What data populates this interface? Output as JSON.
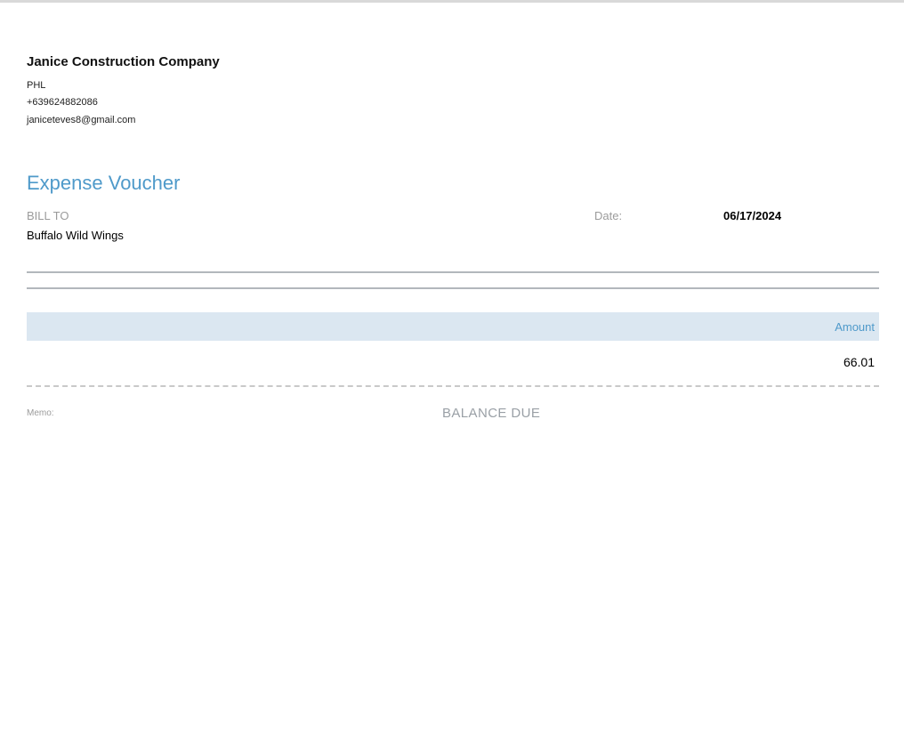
{
  "company": {
    "name": "Janice Construction Company",
    "address": "PHL",
    "phone": "+639624882086",
    "email": "janiceteves8@gmail.com"
  },
  "document": {
    "title": "Expense Voucher"
  },
  "bill_to": {
    "label": "BILL TO",
    "name": "Buffalo Wild Wings"
  },
  "date": {
    "label": "Date:",
    "value": "06/17/2024"
  },
  "table": {
    "columns": [
      {
        "label": "Amount",
        "align": "right"
      }
    ],
    "rows": [
      {
        "amount": "66.01"
      }
    ]
  },
  "footer": {
    "memo_label": "Memo:",
    "balance_due_label": "BALANCE DUE"
  },
  "colors": {
    "accent_blue": "#4f9aca",
    "table_header_bg": "#dbe7f1",
    "muted_gray": "#9b9b9b",
    "rule_gray": "#b2b7bc",
    "top_border_gray": "#d9d9d9"
  }
}
